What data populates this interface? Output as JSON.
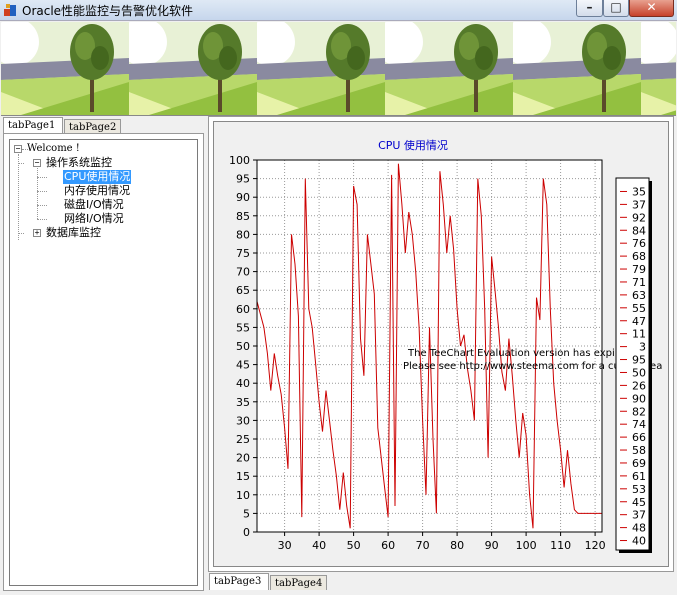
{
  "window": {
    "title": "Oracle性能监控与告警优化软件",
    "minimize": "–",
    "maximize": "□",
    "close": "✕"
  },
  "top_tabs": [
    "tabPage1",
    "tabPage2"
  ],
  "bottom_tabs": [
    "tabPage3",
    "tabPage4"
  ],
  "tree": {
    "root": "Welcome !",
    "group1": "操作系统监控",
    "children": [
      "CPU使用情况",
      "内存使用情况",
      "磁盘I/O情况",
      "网络I/O情况"
    ],
    "group2": "数据库监控",
    "selected": 0
  },
  "colors": {
    "line": "#cc0000",
    "title": "#0000cc",
    "selected_bg": "#3399ff"
  },
  "watermark": {
    "line1": "The TeeChart Evaluation version has expired.",
    "line2": "Please see http://www.steema.com for a current lea"
  },
  "chart_data": {
    "type": "line",
    "title": "CPU 使用情况",
    "xlabel": "",
    "ylabel": "",
    "xlim": [
      22,
      122
    ],
    "ylim": [
      0,
      100
    ],
    "xticks": [
      30,
      40,
      50,
      60,
      70,
      80,
      90,
      100,
      110,
      120
    ],
    "yticks": [
      0,
      5,
      10,
      15,
      20,
      25,
      30,
      35,
      40,
      45,
      50,
      55,
      60,
      65,
      70,
      75,
      80,
      85,
      90,
      95,
      100
    ],
    "grid": true,
    "x": [
      22,
      24,
      25,
      26,
      27,
      28,
      29,
      30,
      31,
      32,
      33,
      34,
      35,
      36,
      37,
      38,
      39,
      40,
      41,
      42,
      43,
      44,
      45,
      46,
      47,
      48,
      49,
      50,
      51,
      52,
      53,
      54,
      55,
      56,
      57,
      58,
      59,
      60,
      61,
      62,
      63,
      64,
      65,
      66,
      67,
      68,
      69,
      70,
      71,
      72,
      73,
      74,
      75,
      76,
      77,
      78,
      79,
      80,
      81,
      82,
      83,
      84,
      85,
      86,
      87,
      88,
      89,
      90,
      91,
      92,
      93,
      94,
      95,
      96,
      97,
      98,
      99,
      100,
      101,
      102,
      103,
      104,
      105,
      106,
      107,
      108,
      109,
      110,
      111,
      112,
      113,
      114,
      115,
      116,
      117,
      118,
      119,
      120,
      121,
      122
    ],
    "y": [
      62,
      55,
      48,
      38,
      48,
      42,
      37,
      28,
      17,
      80,
      72,
      58,
      4,
      95,
      60,
      55,
      45,
      35,
      27,
      38,
      30,
      22,
      15,
      6,
      16,
      7,
      1,
      93,
      88,
      52,
      42,
      80,
      72,
      64,
      28,
      20,
      12,
      4,
      96,
      7,
      99,
      88,
      75,
      86,
      80,
      70,
      55,
      30,
      10,
      55,
      25,
      5,
      97,
      88,
      75,
      85,
      76,
      60,
      50,
      53,
      44,
      38,
      30,
      95,
      85,
      60,
      20,
      74,
      65,
      55,
      43,
      38,
      52,
      42,
      30,
      20,
      32,
      26,
      10,
      1,
      63,
      57,
      95,
      88,
      60,
      40,
      30,
      22,
      12,
      22,
      13,
      6,
      5,
      5,
      5,
      5,
      5,
      5,
      5,
      5
    ],
    "legend": {
      "placement": "right",
      "entries": [
        "35",
        "37",
        "92",
        "84",
        "76",
        "68",
        "79",
        "71",
        "63",
        "55",
        "47",
        "11",
        "3",
        "95",
        "50",
        "26",
        "90",
        "82",
        "74",
        "66",
        "58",
        "69",
        "61",
        "53",
        "45",
        "37",
        "48",
        "40"
      ]
    }
  }
}
